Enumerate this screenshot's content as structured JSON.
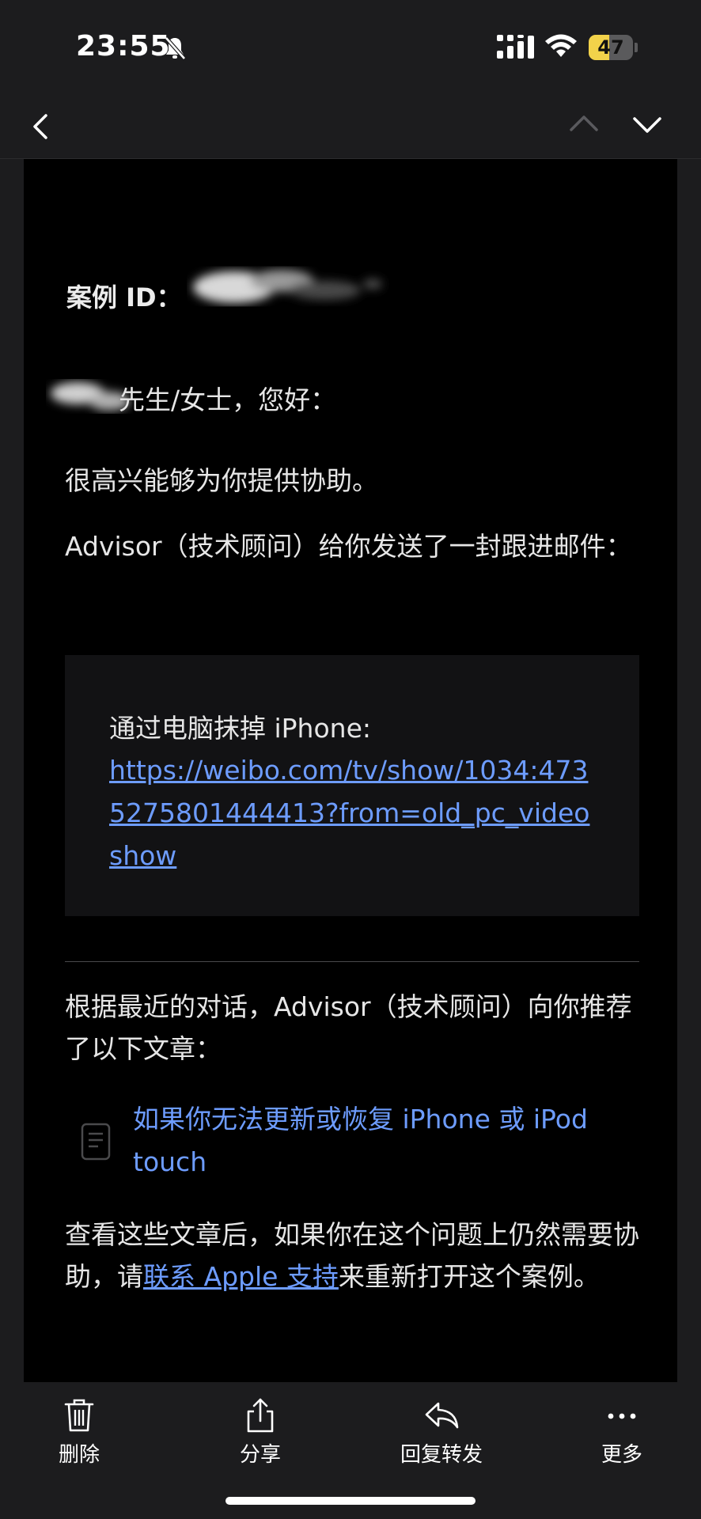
{
  "status_bar": {
    "time": "23:55",
    "battery": "47",
    "battery_level": 0.47
  },
  "nav": {
    "back_icon": "chevron-left-icon",
    "prev_icon": "chevron-up-icon",
    "next_icon": "chevron-down-icon"
  },
  "email": {
    "case_label": "案例 ID：",
    "greeting": "先生/女士，您好：",
    "paragraph1": "很高兴能够为你提供协助。",
    "paragraph2": "Advisor（技术顾问）给你发送了一封跟进邮件：",
    "quote_title": "通过电脑抹掉 iPhone:",
    "quote_link": "https://weibo.com/tv/show/1034:4735275801444413?from=old_pc_videoshow",
    "paragraph3": "根据最近的对话，Advisor（技术顾问）向你推荐了以下文章：",
    "article_title": "如果你无法更新或恢复 iPhone 或 iPod touch",
    "paragraph4_before": "查看这些文章后，如果你在这个问题上仍然需要协助，请",
    "paragraph4_link": "联系 Apple 支持",
    "paragraph4_after": "来重新打开这个案例。"
  },
  "toolbar": {
    "delete_label": "删除",
    "share_label": "分享",
    "reply_label": "回复转发",
    "more_label": "更多"
  },
  "colors": {
    "link": "#6d9cff",
    "battery": "#f2d24a",
    "background": "#000000",
    "bars": "#1c1c1e"
  }
}
